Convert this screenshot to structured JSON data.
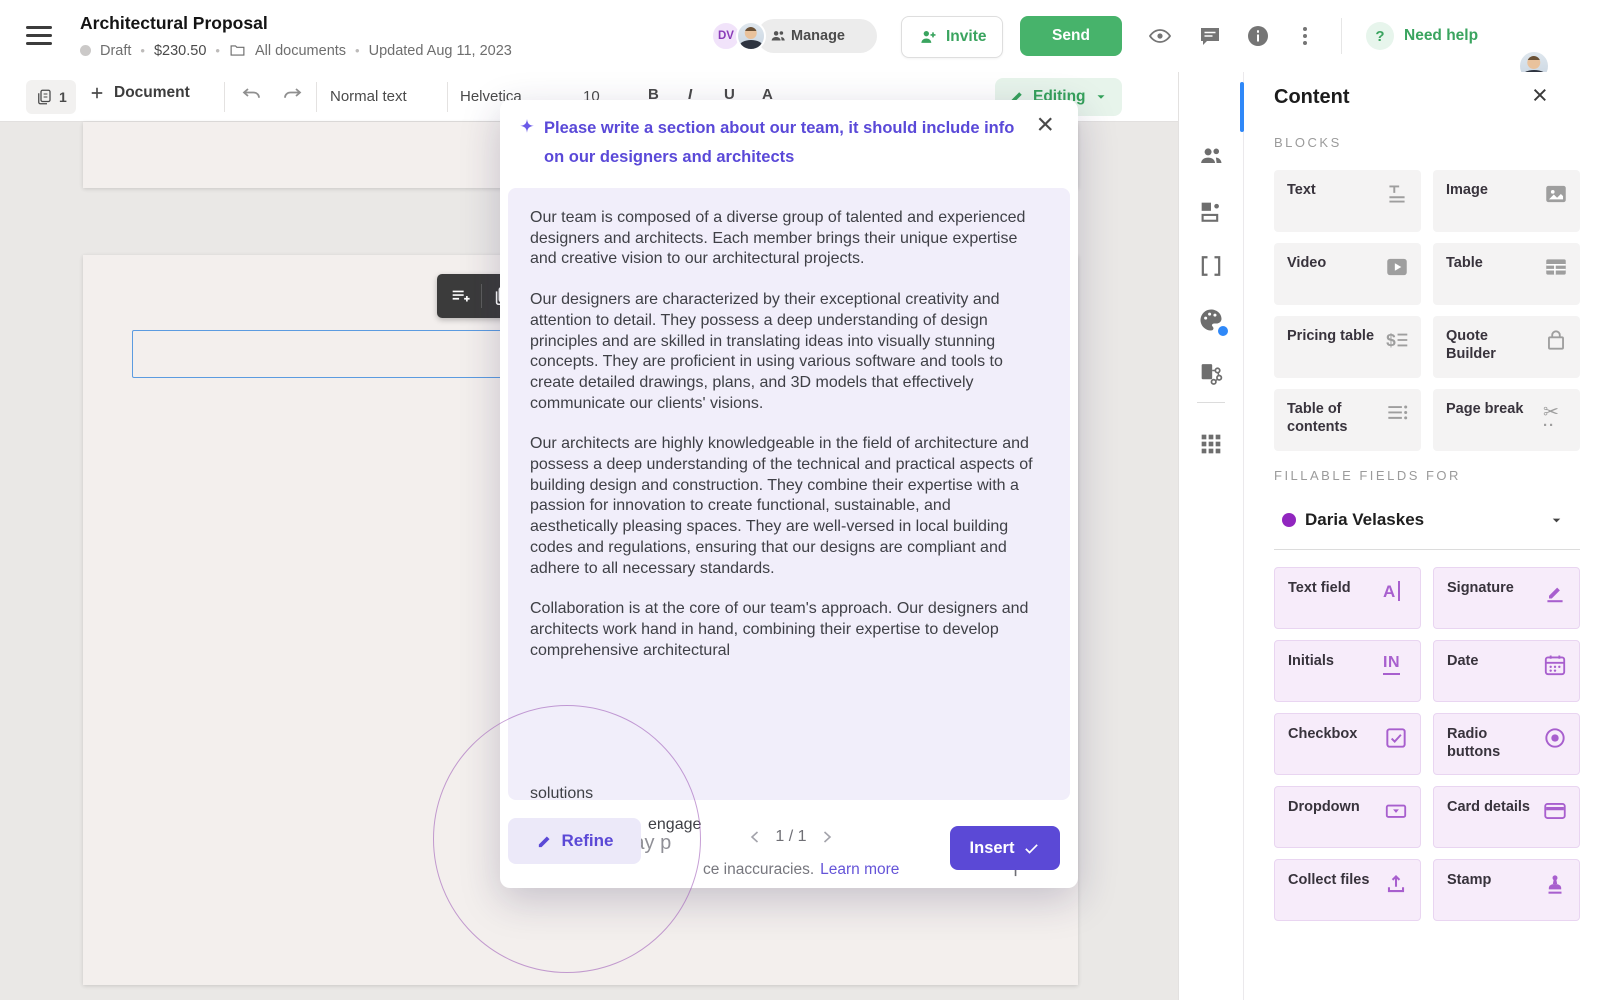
{
  "header": {
    "title": "Architectural Proposal",
    "status": "Draft",
    "amount": "$230.50",
    "folder": "All documents",
    "updated": "Updated Aug 11, 2023",
    "separator": "•",
    "avatar_initials": "DV",
    "manage_label": "Manage",
    "invite_label": "Invite",
    "send_label": "Send",
    "help_mark": "?",
    "need_help_label": "Need help"
  },
  "toolbar": {
    "page_count": "1",
    "document_label": "Document",
    "style_label": "Normal text",
    "font_label": "Helvetica",
    "font_size": "10",
    "format_buttons": [
      "B",
      "I",
      "U",
      "A"
    ],
    "editing_label": "Editing"
  },
  "modal": {
    "prompt": "Please write a section about our team, it should include info on our designers and architects",
    "close_glyph": "×",
    "paragraphs": [
      "Our team is composed of a diverse group of talented and experienced designers and architects. Each member brings their unique expertise and creative vision to our architectural projects.",
      "Our designers are characterized by their exceptional creativity and attention to detail. They possess a deep understanding of design principles and are skilled in translating ideas into visually stunning concepts. They are proficient in using various software and tools to create detailed drawings, plans, and 3D models that effectively communicate our clients' visions.",
      "Our architects are highly knowledgeable in the field of architecture and possess a deep understanding of the technical and practical aspects of building design and construction. They combine their expertise with a passion for innovation to create functional, sustainable, and aesthetically pleasing spaces. They are well-versed in local building codes and regulations, ensuring that our designs are compliant and adhere to all necessary standards.",
      "Collaboration is at the core of our team's approach. Our designers and architects work hand in hand, combining their expertise to develop comprehensive architectural"
    ],
    "fragment_solutions": "solutions",
    "fragment_engage": "engage",
    "disclaimer_partial_big": "Panda AI may p",
    "disclaimer_partial_small": "ce inaccuracies.",
    "learn_more_label": "Learn more",
    "refine_label": "Refine",
    "pagination": "1 / 1",
    "insert_label": "Insert"
  },
  "sidebar": {
    "title": "Content",
    "close_glyph": "×",
    "blocks_heading": "BLOCKS",
    "blocks": [
      {
        "label": "Text",
        "icon": "text-block-icon"
      },
      {
        "label": "Image",
        "icon": "image-icon"
      },
      {
        "label": "Video",
        "icon": "video-icon"
      },
      {
        "label": "Table",
        "icon": "table-icon"
      },
      {
        "label": "Pricing table",
        "icon": "pricing-table-icon"
      },
      {
        "label": "Quote Builder",
        "icon": "quote-builder-icon"
      },
      {
        "label": "Table of contents",
        "icon": "table-of-contents-icon"
      },
      {
        "label": "Page break",
        "icon": "page-break-icon"
      }
    ],
    "fillable_heading": "FILLABLE FIELDS FOR",
    "assignee": "Daria Velaskes",
    "fields": [
      {
        "label": "Text field",
        "icon": "text-field-icon"
      },
      {
        "label": "Signature",
        "icon": "signature-icon"
      },
      {
        "label": "Initials",
        "icon": "initials-icon"
      },
      {
        "label": "Date",
        "icon": "date-icon"
      },
      {
        "label": "Checkbox",
        "icon": "checkbox-icon"
      },
      {
        "label": "Radio buttons",
        "icon": "radio-buttons-icon"
      },
      {
        "label": "Dropdown",
        "icon": "dropdown-icon"
      },
      {
        "label": "Card details",
        "icon": "card-details-icon"
      },
      {
        "label": "Collect files",
        "icon": "collect-files-icon"
      },
      {
        "label": "Stamp",
        "icon": "stamp-icon"
      }
    ]
  },
  "colors": {
    "accent_purple": "#5b49d6",
    "accent_green": "#47b36b",
    "accent_blue": "#2f88f8",
    "field_purple": "#a85fce",
    "assignee_dot": "#9126bf",
    "annotation_circle": "#a05fb9",
    "lavender_panel": "#f1eefa",
    "canvas_gray": "#eae8e6"
  }
}
